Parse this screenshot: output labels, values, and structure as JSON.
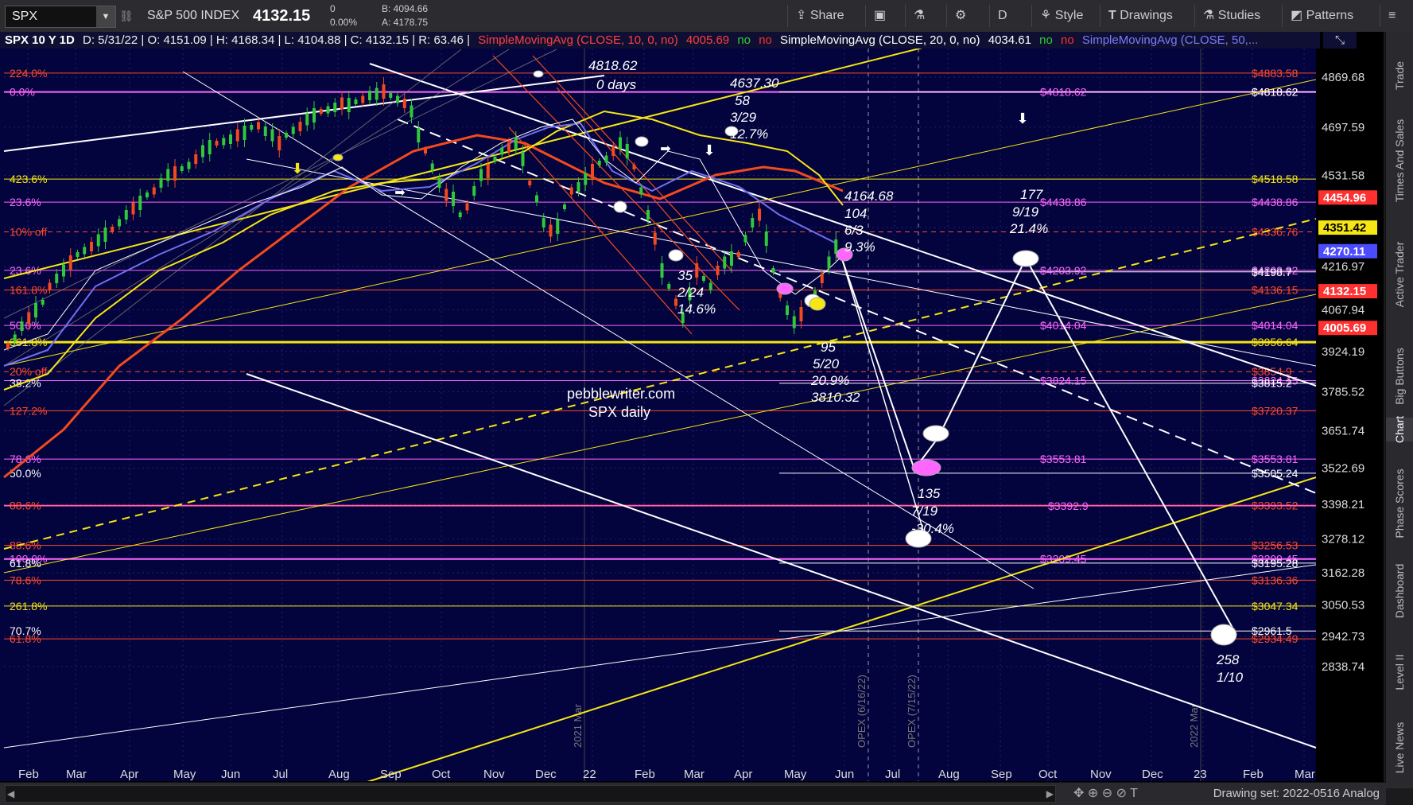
{
  "toolbar": {
    "symbol": "SPX",
    "index_name": "S&P 500 INDEX",
    "last": "4132.15",
    "net_change": "0",
    "pct_change": "0.00%",
    "bid": "B: 4094.66",
    "ask": "A: 4178.75",
    "buttons": {
      "share": "Share",
      "period": "D",
      "style": "Style",
      "drawings": "Drawings",
      "studies": "Studies",
      "patterns": "Patterns"
    }
  },
  "study_bar": {
    "header": "SPX 10 Y 1D",
    "ohlc": "D: 5/31/22 | O: 4151.09 | H: 4168.34 | L: 4104.88 | C: 4132.15 | R: 63.46 |",
    "sma10_name": "SimpleMovingAvg (CLOSE, 10, 0, no)",
    "sma10_value": "4005.69",
    "sma20_name": "SimpleMovingAvg (CLOSE, 20, 0, no)",
    "sma20_value": "4034.61",
    "sma50_name": "SimpleMovingAvg (CLOSE, 50,...",
    "no": "no"
  },
  "right_tabs": [
    "Trade",
    "Times And Sales",
    "Active Trader",
    "Big Buttons",
    "Chart",
    "Phase Scores",
    "Dashboard",
    "Level II",
    "Live News"
  ],
  "bottom_bar": {
    "drawing_set": "Drawing set: 2022-0516 Analog"
  },
  "colors": {
    "chart_bg": "#03033d",
    "white_line": "#ffffff",
    "yellow": "#f5e614",
    "red": "#f24a1e",
    "magenta": "#ff4fff",
    "blue": "#6f6ff0",
    "price_box_red": "#ff3030",
    "price_box_yellow": "#f5e614",
    "price_box_blue": "#4b4bff"
  },
  "price_axis": [
    "4869.68",
    "4697.59",
    "4531.58",
    "4351.42",
    "4216.97",
    "4067.94",
    "3924.19",
    "3785.52",
    "3651.74",
    "3522.69",
    "3398.21",
    "3278.12",
    "3162.28",
    "3050.53",
    "2942.73",
    "2838.74"
  ],
  "price_boxes": [
    {
      "label": "4454.96",
      "price": 4454.96,
      "color": "#ff3030",
      "text": "#ffffff"
    },
    {
      "label": "4351.42",
      "price": 4351.42,
      "color": "#f5e614",
      "text": "#000000"
    },
    {
      "label": "4270.11",
      "price": 4270.11,
      "color": "#4b4bff",
      "text": "#ffffff"
    },
    {
      "label": "4132.15",
      "price": 4132.15,
      "color": "#ff3030",
      "text": "#ffffff"
    },
    {
      "label": "4005.69",
      "price": 4005.69,
      "color": "#ff3030",
      "text": "#ffffff"
    }
  ],
  "time_axis": [
    "Feb",
    "Mar",
    "Apr",
    "May",
    "Jun",
    "Jul",
    "Aug",
    "Sep",
    "Oct",
    "Nov",
    "Dec",
    "22",
    "Feb",
    "Mar",
    "Apr",
    "May",
    "Jun",
    "Jul",
    "Aug",
    "Sep",
    "Oct",
    "Nov",
    "Dec",
    "23",
    "Feb",
    "Mar"
  ],
  "vertical_markers": [
    "2021 Mar",
    "OPEX (6/16/22)",
    "OPEX (7/15/22)",
    "2022 Mar"
  ],
  "fib_left_labels": [
    {
      "text": "224.0%",
      "color": "#ff4a2a",
      "price": 4883.58
    },
    {
      "text": "0.0%",
      "color": "#ff66ff",
      "price": 4818.62
    },
    {
      "text": "423.6%",
      "color": "#f5e614",
      "price": 4518.58
    },
    {
      "text": "23.6%",
      "color": "#ff66ff",
      "price": 4438.86
    },
    {
      "text": "10% off",
      "color": "#ff4a2a",
      "price": 4336.76
    },
    {
      "text": "23.6%",
      "color": "#ff66ff",
      "price": 4203.92
    },
    {
      "text": "161.8%",
      "color": "#ff4a2a",
      "price": 4136.15
    },
    {
      "text": "50.0%",
      "color": "#ff66ff",
      "price": 4014.04
    },
    {
      "text": "361.8%",
      "color": "#f5e614",
      "price": 3956.64
    },
    {
      "text": "20% off",
      "color": "#ff4a2a",
      "price": 3854.9
    },
    {
      "text": "38.2%",
      "color": "#ffffff",
      "price": 3815.2
    },
    {
      "text": "127.2%",
      "color": "#ff4a2a",
      "price": 3720.37
    },
    {
      "text": "78.6%",
      "color": "#ff66ff",
      "price": 3553.81
    },
    {
      "text": "50.0%",
      "color": "#ffffff",
      "price": 3505.24
    },
    {
      "text": "88.6%",
      "color": "#ff4a2a",
      "price": 3393.52
    },
    {
      "text": "88.6%",
      "color": "#ff4a2a",
      "price": 3256.53
    },
    {
      "text": "100.0%",
      "color": "#ff66ff",
      "price": 3209.45
    },
    {
      "text": "61.8%",
      "color": "#ffffff",
      "price": 3195.28
    },
    {
      "text": "78.6%",
      "color": "#ff4a2a",
      "price": 3136.36
    },
    {
      "text": "261.8%",
      "color": "#f5e614",
      "price": 3047.34
    },
    {
      "text": "70.7%",
      "color": "#ffffff",
      "price": 2961.5
    },
    {
      "text": "61.8%",
      "color": "#ff4a2a",
      "price": 2934.49
    }
  ],
  "level_lines": [
    {
      "price": 4883.58,
      "label": "$4883.58",
      "color": "#ff4a2a",
      "text": "#ff4a2a",
      "dash": false,
      "width": 1
    },
    {
      "price": 4818.62,
      "label": "$4818.62",
      "color": "#ff66ff",
      "text": "#ff66ff",
      "dash": false,
      "width": 2
    },
    {
      "price": 4818.62,
      "label": "$4818.62",
      "color": "#ffffff",
      "text": "#ffffff",
      "dash": false,
      "width": 1,
      "right": true
    },
    {
      "price": 4518.58,
      "label": "$4518.58",
      "color": "#f5e614",
      "text": "#f5e614",
      "dash": false,
      "width": 1
    },
    {
      "price": 4438.86,
      "label": "$4438.86",
      "color": "#ff66ff",
      "text": "#ff66ff",
      "dash": false,
      "width": 1
    },
    {
      "price": 4336.76,
      "label": "$4336.76",
      "color": "#ff4a2a",
      "text": "#ff4a2a",
      "dash": true,
      "width": 1
    },
    {
      "price": 4203.92,
      "label": "$4203.92",
      "color": "#ff66ff",
      "text": "#ff66ff",
      "dash": false,
      "width": 1
    },
    {
      "price": 4198.7,
      "label": "$4198.7",
      "color": "#ffffff",
      "text": "#ffffff",
      "dash": false,
      "width": 1,
      "right": true
    },
    {
      "price": 4136.15,
      "label": "$4136.15",
      "color": "#ff4a2a",
      "text": "#ff4a2a",
      "dash": false,
      "width": 1
    },
    {
      "price": 4014.04,
      "label": "$4014.04",
      "color": "#ff66ff",
      "text": "#ff66ff",
      "dash": false,
      "width": 1
    },
    {
      "price": 3956.64,
      "label": "$3956.64",
      "color": "#f5e614",
      "text": "#f5e614",
      "dash": false,
      "width": 3
    },
    {
      "price": 3854.9,
      "label": "$3854.9",
      "color": "#ff4a2a",
      "text": "#ff4a2a",
      "dash": true,
      "width": 1
    },
    {
      "price": 3824.15,
      "label": "$3824.15",
      "color": "#ff66ff",
      "text": "#ff66ff",
      "dash": false,
      "width": 1
    },
    {
      "price": 3815.2,
      "label": "$3815.2",
      "color": "#ffffff",
      "text": "#ffffff",
      "dash": false,
      "width": 1,
      "right": true
    },
    {
      "price": 3720.37,
      "label": "$3720.37",
      "color": "#ff4a2a",
      "text": "#ff4a2a",
      "dash": false,
      "width": 1
    },
    {
      "price": 3553.81,
      "label": "$3553.81",
      "color": "#ff66ff",
      "text": "#ff66ff",
      "dash": false,
      "width": 1
    },
    {
      "price": 3505.24,
      "label": "$3505.24",
      "color": "#ffffff",
      "text": "#ffffff",
      "dash": false,
      "width": 1,
      "right": true
    },
    {
      "price": 3393.52,
      "label": "$3393.52",
      "color": "#ff4a2a",
      "text": "#ff4a2a",
      "dash": false,
      "width": 2
    },
    {
      "price": 3392.9,
      "label": "$3392.9",
      "color": "#ff66ff",
      "text": "#ff66ff",
      "dash": false,
      "width": 1,
      "mid": true
    },
    {
      "price": 3256.53,
      "label": "$3256.53",
      "color": "#ff4a2a",
      "text": "#ff4a2a",
      "dash": false,
      "width": 1
    },
    {
      "price": 3209.45,
      "label": "$3209.45",
      "color": "#ff66ff",
      "text": "#ff66ff",
      "dash": false,
      "width": 2
    },
    {
      "price": 3195.28,
      "label": "$3195.28",
      "color": "#ffffff",
      "text": "#ffffff",
      "dash": false,
      "width": 1,
      "right": true
    },
    {
      "price": 3136.36,
      "label": "$3136.36",
      "color": "#ff4a2a",
      "text": "#ff4a2a",
      "dash": false,
      "width": 1
    },
    {
      "price": 3047.34,
      "label": "$3047.34",
      "color": "#f5e614",
      "text": "#f5e614",
      "dash": false,
      "width": 1
    },
    {
      "price": 2961.5,
      "label": "$2961.5",
      "color": "#ffffff",
      "text": "#ffffff",
      "dash": false,
      "width": 1,
      "right": true
    },
    {
      "price": 2934.49,
      "label": "$2934.49",
      "color": "#ff4a2a",
      "text": "#ff4a2a",
      "dash": false,
      "width": 1
    }
  ],
  "annotations": {
    "ath_price": "4818.62",
    "ath_days": "0 days",
    "peak2_price": "4637.30",
    "peak2_days": "58",
    "peak2_date": "3/29",
    "peak2_pct": "12.7%",
    "current_price": "4164.68",
    "current_days": "104",
    "current_date": "6/3",
    "current_pct": "9.3%",
    "target1_days": "177",
    "target1_date": "9/19",
    "target1_pct": "21.4%",
    "low1_days": "35",
    "low1_date": "2/24",
    "low1_pct": "14.6%",
    "low2_days": "95",
    "low2_date": "5/20",
    "low2_pct": "20.9%",
    "low2_price": "3810.32",
    "watermark1": "pebblewriter.com",
    "watermark2": "SPX daily",
    "low3_days": "135",
    "low3_date": "7/19",
    "low3_pct": "-30.4%",
    "low4_days": "258",
    "low4_date": "1/10"
  }
}
